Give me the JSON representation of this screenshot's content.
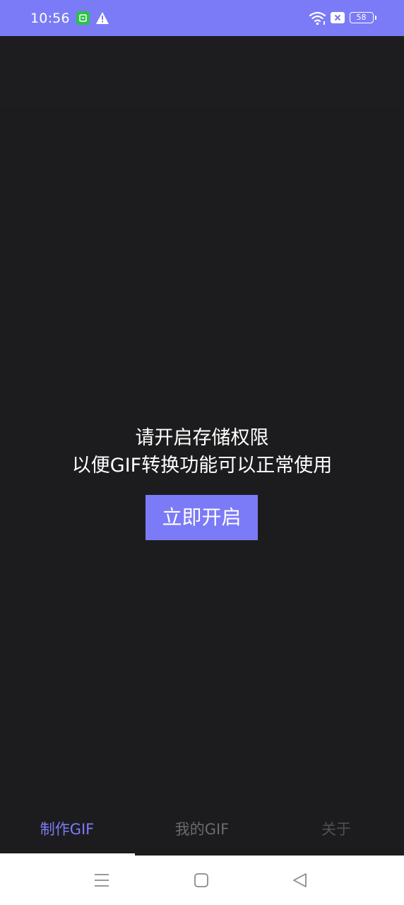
{
  "status_bar": {
    "time": "10:56",
    "battery": "58",
    "color": "#7b7bf7",
    "icons": [
      "app-notification-icon",
      "warning-icon",
      "wifi-icon",
      "sim-icon",
      "battery-icon"
    ]
  },
  "permission": {
    "line1": "请开启存储权限",
    "line2": "以便GIF转换功能可以正常使用",
    "button_label": "立即开启"
  },
  "tabs": [
    {
      "label": "制作GIF",
      "selected": true
    },
    {
      "label": "我的GIF",
      "selected": false
    },
    {
      "label": "关于",
      "selected": false
    }
  ],
  "nav_bar": {
    "icons": [
      "menu-icon",
      "home-icon",
      "back-icon"
    ]
  },
  "colors": {
    "accent": "#7b7bf7",
    "background": "#1c1c1e",
    "tab_inactive": "#6b6b70",
    "tab_dim": "#505055"
  }
}
